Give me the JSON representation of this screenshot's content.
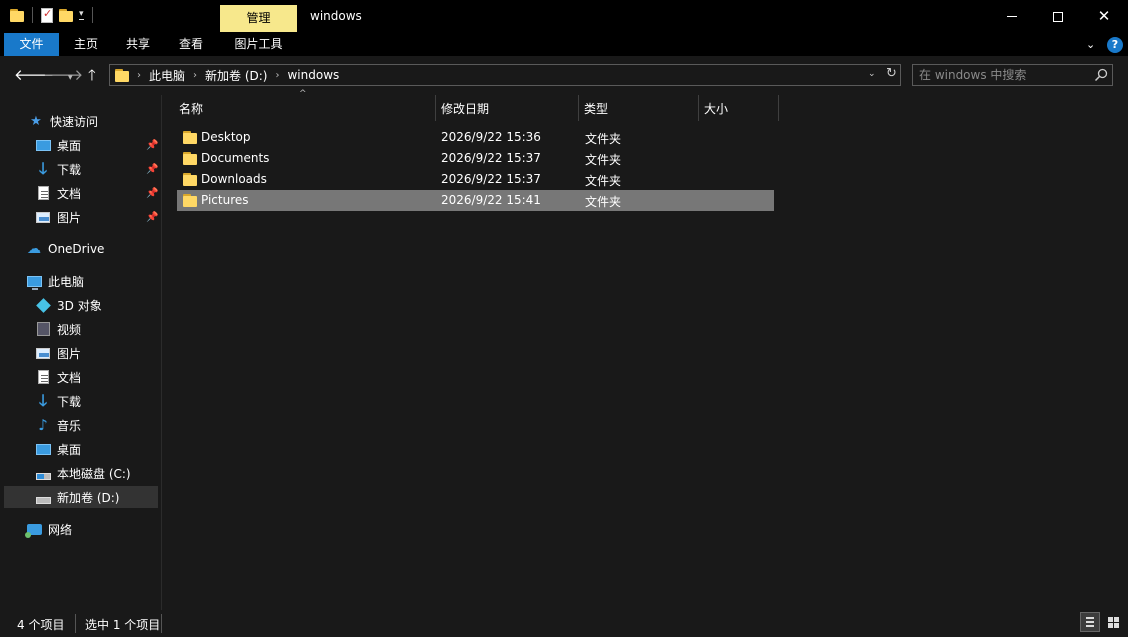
{
  "window": {
    "title": "windows",
    "context_tab": "管理"
  },
  "ribbon": {
    "tabs": [
      "文件",
      "主页",
      "共享",
      "查看",
      "图片工具"
    ]
  },
  "address": {
    "crumbs": [
      "此电脑",
      "新加卷 (D:)",
      "windows"
    ]
  },
  "search": {
    "placeholder": "在 windows 中搜索"
  },
  "sidebar": {
    "quick_access": "快速访问",
    "quick_items": [
      "桌面",
      "下载",
      "文档",
      "图片"
    ],
    "onedrive": "OneDrive",
    "this_pc": "此电脑",
    "pc_items": [
      "3D 对象",
      "视频",
      "图片",
      "文档",
      "下载",
      "音乐",
      "桌面",
      "本地磁盘 (C:)",
      "新加卷 (D:)"
    ],
    "network": "网络"
  },
  "columns": {
    "name": "名称",
    "date": "修改日期",
    "type": "类型",
    "size": "大小"
  },
  "files": [
    {
      "name": "Desktop",
      "date": "2026/9/22 15:36",
      "type": "文件夹",
      "size": ""
    },
    {
      "name": "Documents",
      "date": "2026/9/22 15:37",
      "type": "文件夹",
      "size": ""
    },
    {
      "name": "Downloads",
      "date": "2026/9/22 15:37",
      "type": "文件夹",
      "size": ""
    },
    {
      "name": "Pictures",
      "date": "2026/9/22 15:41",
      "type": "文件夹",
      "size": ""
    }
  ],
  "selected_file": "Pictures",
  "status": {
    "item_count": "4 个项目",
    "selection": "选中 1 个项目"
  },
  "colors": {
    "accent": "#1979ca",
    "context_tab": "#f7e88c",
    "background": "#191919",
    "selection": "#777777"
  }
}
